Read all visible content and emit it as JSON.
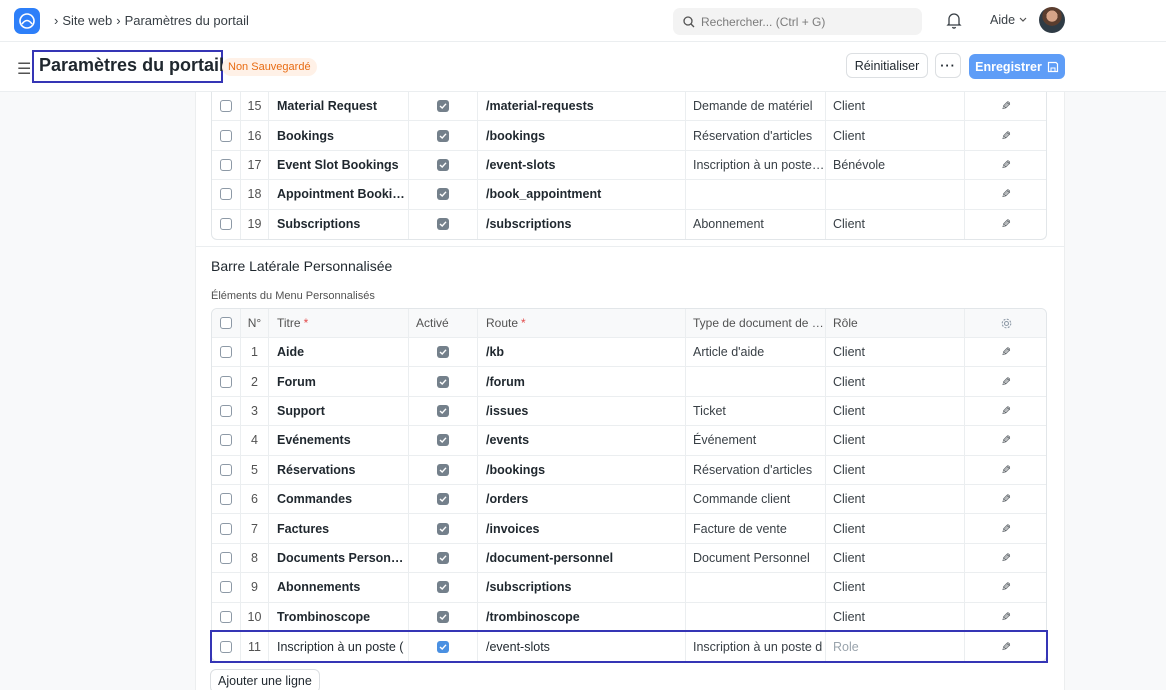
{
  "navbar": {
    "breadcrumbs": [
      "Site web",
      "Paramètres du portail"
    ],
    "search_placeholder": "Rechercher... (Ctrl + G)",
    "help_label": "Aide"
  },
  "page_head": {
    "title": "Paramètres du portail",
    "status": "Non Sauvegardé",
    "reset_label": "Réinitialiser",
    "more_label": "···",
    "save_label": "Enregistrer"
  },
  "menu_table_rows": [
    {
      "idx": "15",
      "title": "Material Request",
      "active": true,
      "route": "/material-requests",
      "doctype": "Demande de matériel",
      "role": "Client"
    },
    {
      "idx": "16",
      "title": "Bookings",
      "active": true,
      "route": "/bookings",
      "doctype": "Réservation d'articles",
      "role": "Client"
    },
    {
      "idx": "17",
      "title": "Event Slot Bookings",
      "active": true,
      "route": "/event-slots",
      "doctype": "Inscription à un poste…",
      "role": "Bénévole"
    },
    {
      "idx": "18",
      "title": "Appointment Booki…",
      "active": true,
      "route": "/book_appointment",
      "doctype": "",
      "role": ""
    },
    {
      "idx": "19",
      "title": "Subscriptions",
      "active": true,
      "route": "/subscriptions",
      "doctype": "Abonnement",
      "role": "Client"
    }
  ],
  "custom_sidebar": {
    "section_title": "Barre Latérale Personnalisée",
    "field_label": "Éléments du Menu Personnalisés",
    "columns": {
      "idx": "N°",
      "title": "Titre",
      "active": "Activé",
      "route": "Route",
      "doctype": "Type de document de …",
      "role": "Rôle",
      "required_mark": "*"
    },
    "rows": [
      {
        "idx": "1",
        "title": "Aide",
        "active": true,
        "route": "/kb",
        "doctype": "Article d'aide",
        "role": "Client"
      },
      {
        "idx": "2",
        "title": "Forum",
        "active": true,
        "route": "/forum",
        "doctype": "",
        "role": "Client"
      },
      {
        "idx": "3",
        "title": "Support",
        "active": true,
        "route": "/issues",
        "doctype": "Ticket",
        "role": "Client"
      },
      {
        "idx": "4",
        "title": "Evénements",
        "active": true,
        "route": "/events",
        "doctype": "Événement",
        "role": "Client"
      },
      {
        "idx": "5",
        "title": "Réservations",
        "active": true,
        "route": "/bookings",
        "doctype": "Réservation d'articles",
        "role": "Client"
      },
      {
        "idx": "6",
        "title": "Commandes",
        "active": true,
        "route": "/orders",
        "doctype": "Commande client",
        "role": "Client"
      },
      {
        "idx": "7",
        "title": "Factures",
        "active": true,
        "route": "/invoices",
        "doctype": "Facture de vente",
        "role": "Client"
      },
      {
        "idx": "8",
        "title": "Documents Person…",
        "active": true,
        "route": "/document-personnel",
        "doctype": "Document Personnel",
        "role": "Client"
      },
      {
        "idx": "9",
        "title": "Abonnements",
        "active": true,
        "route": "/subscriptions",
        "doctype": "",
        "role": "Client"
      },
      {
        "idx": "10",
        "title": "Trombinoscope",
        "active": true,
        "route": "/trombinoscope",
        "doctype": "",
        "role": "Client"
      }
    ],
    "editing_row": {
      "idx": "11",
      "title": "Inscription à un poste (",
      "active": true,
      "route": "/event-slots",
      "doctype": "Inscription à un poste d",
      "role_placeholder": "Role"
    },
    "add_row_label": "Ajouter une ligne"
  },
  "colors": {
    "accent": "#2d7ff9",
    "save_button": "#5e9df7",
    "highlight_border": "#3535b5",
    "status_text": "#e86c13"
  }
}
